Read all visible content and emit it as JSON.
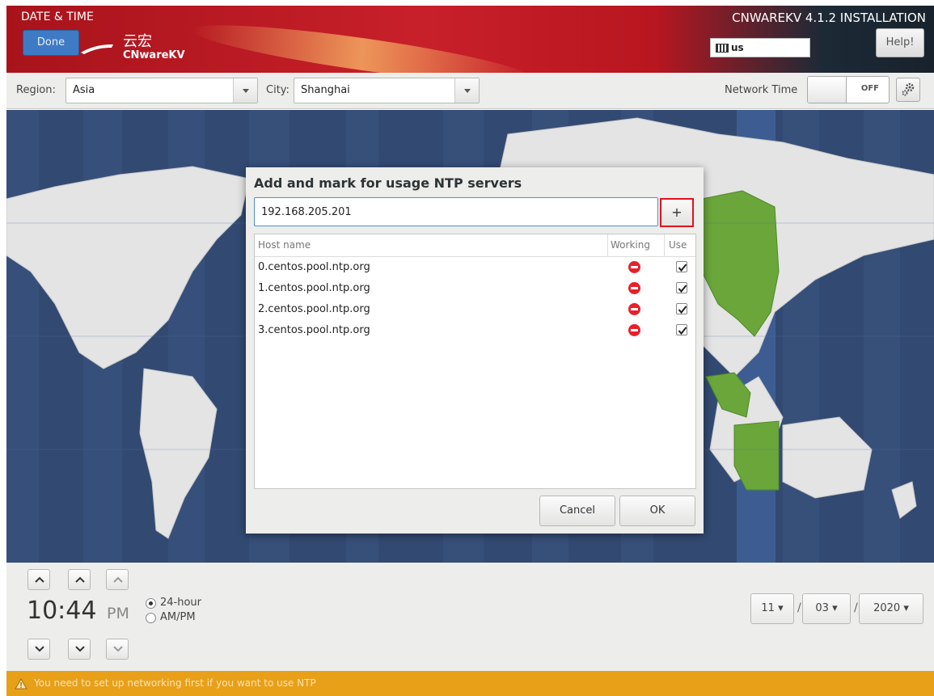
{
  "header": {
    "title": "DATE & TIME",
    "done_label": "Done",
    "logo_cn": "云宏",
    "logo_en": "CNwareKV",
    "install_title": "CNWAREKV 4.1.2 INSTALLATION",
    "keyboard_layout": "us",
    "help_label": "Help!"
  },
  "toolbar": {
    "region_label": "Region:",
    "region_value": "Asia",
    "city_label": "City:",
    "city_value": "Shanghai",
    "network_time_label": "Network Time",
    "network_time_state": "OFF"
  },
  "dialog": {
    "title": "Add and mark for usage NTP servers",
    "input_value": "192.168.205.201",
    "add_label": "+",
    "columns": [
      "Host name",
      "Working",
      "Use"
    ],
    "servers": [
      {
        "host": "0.centos.pool.ntp.org",
        "working": false,
        "use": true
      },
      {
        "host": "1.centos.pool.ntp.org",
        "working": false,
        "use": true
      },
      {
        "host": "2.centos.pool.ntp.org",
        "working": false,
        "use": true
      },
      {
        "host": "3.centos.pool.ntp.org",
        "working": false,
        "use": true
      }
    ],
    "cancel_label": "Cancel",
    "ok_label": "OK"
  },
  "time": {
    "hour_minute": "10:44",
    "period": "PM",
    "format_24": "24-hour",
    "format_ampm": "AM/PM",
    "selected_format": "24-hour"
  },
  "date": {
    "month": "11",
    "day": "03",
    "year": "2020",
    "separator": "/"
  },
  "warning": {
    "message": "You need to set up networking first if you want to use NTP"
  },
  "colors": {
    "header_red": "#c8202a",
    "accent_blue": "#3e7bc4",
    "map_ocean": "#324a72",
    "highlight_zone": "#6aa63a",
    "warning_orange": "#e8a019",
    "highlight_border": "#e0121a"
  },
  "icons": {
    "keyboard": "keyboard-icon",
    "settings": "gear-icon",
    "warning": "warning-icon",
    "not_working": "stop-icon",
    "checked": "checkbox-checked-icon"
  }
}
